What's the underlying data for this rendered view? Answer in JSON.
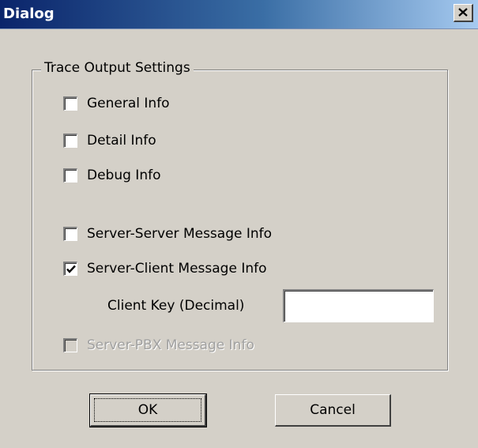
{
  "window": {
    "title": "Dialog",
    "close_glyph": "✕"
  },
  "group": {
    "legend": "Trace Output Settings"
  },
  "checkboxes": [
    {
      "label": "General Info",
      "checked": false,
      "enabled": true
    },
    {
      "label": "Detail Info",
      "checked": false,
      "enabled": true
    },
    {
      "label": "Debug Info",
      "checked": false,
      "enabled": true
    },
    {
      "label": "Server-Server Message Info",
      "checked": false,
      "enabled": true
    },
    {
      "label": "Server-Client Message Info",
      "checked": true,
      "enabled": true
    },
    {
      "label": "Server-PBX Message Info",
      "checked": false,
      "enabled": false
    }
  ],
  "client_key": {
    "label": "Client Key (Decimal)",
    "value": ""
  },
  "buttons": {
    "ok": "OK",
    "cancel": "Cancel"
  },
  "icons": {
    "close": "close-icon",
    "check": "check-icon"
  }
}
